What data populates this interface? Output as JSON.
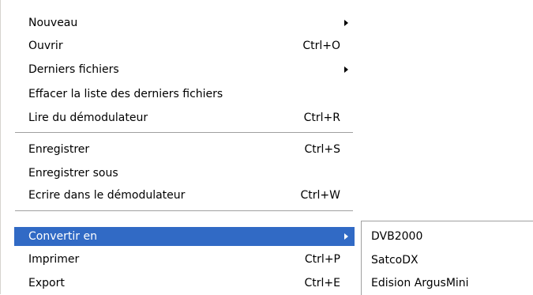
{
  "menu": {
    "items": [
      {
        "label": "Nouveau",
        "shortcut": "",
        "submenu": true
      },
      {
        "label": "Ouvrir",
        "shortcut": "Ctrl+O",
        "submenu": false
      },
      {
        "label": "Derniers fichiers",
        "shortcut": "",
        "submenu": true
      },
      {
        "label": "Effacer la liste des derniers fichiers",
        "shortcut": "",
        "submenu": false
      },
      {
        "label": "Lire du démodulateur",
        "shortcut": "Ctrl+R",
        "submenu": false
      },
      {
        "label": "Enregistrer",
        "shortcut": "Ctrl+S",
        "submenu": false
      },
      {
        "label": "Enregistrer sous",
        "shortcut": "",
        "submenu": false
      },
      {
        "label": "Ecrire dans le démodulateur",
        "shortcut": "Ctrl+W",
        "submenu": false
      },
      {
        "label": "Convertir en",
        "shortcut": "",
        "submenu": true,
        "highlighted": true
      },
      {
        "label": "Imprimer",
        "shortcut": "Ctrl+P",
        "submenu": false
      },
      {
        "label": "Export",
        "shortcut": "Ctrl+E",
        "submenu": false
      }
    ]
  },
  "submenu": {
    "items": [
      {
        "label": "DVB2000"
      },
      {
        "label": "SatcoDX"
      },
      {
        "label": "Edision ArgusMini"
      }
    ]
  },
  "colors": {
    "highlight": "#316ac5",
    "highlight_text": "#ffffff",
    "separator": "#a0a0a0"
  }
}
